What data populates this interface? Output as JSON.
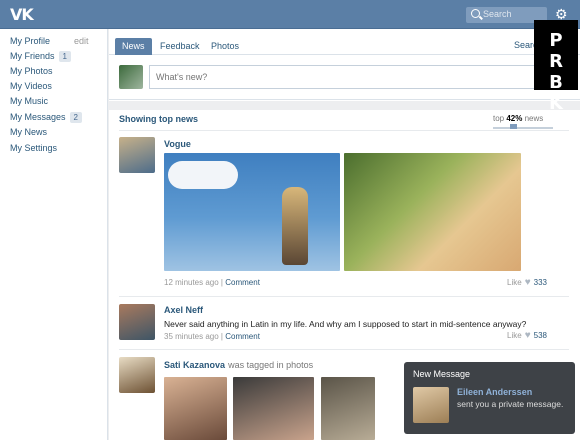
{
  "header": {
    "logo": "VK",
    "search_placeholder": "Search"
  },
  "sidebar": {
    "edit_label": "edit",
    "items": [
      {
        "label": "My Profile"
      },
      {
        "label": "My Friends",
        "badge": "1"
      },
      {
        "label": "My Photos"
      },
      {
        "label": "My Videos"
      },
      {
        "label": "My Music"
      },
      {
        "label": "My Messages",
        "badge": "2"
      },
      {
        "label": "My News"
      },
      {
        "label": "My Settings"
      }
    ]
  },
  "tabs": [
    {
      "label": "News",
      "active": true
    },
    {
      "label": "Feedback"
    },
    {
      "label": "Photos"
    }
  ],
  "tabs_search_label": "Searc",
  "composer": {
    "placeholder": "What's new?"
  },
  "feed": {
    "header": "Showing top news",
    "top_prefix": "top",
    "top_percent": "42%",
    "top_suffix": "news",
    "top_fraction": 0.42
  },
  "posts": [
    {
      "author": "Vogue",
      "time": "12 minutes ago",
      "comment": "Comment",
      "like": "Like",
      "likes": "333"
    },
    {
      "author": "Axel Neff",
      "text": "Never said anything in Latin in my life. And why am I supposed to start in mid-sentence anyway?",
      "time": "35 minutes ago",
      "comment": "Comment",
      "like": "Like",
      "likes": "538"
    },
    {
      "author": "Sati Kazanova",
      "tag_text": "was tagged in photos"
    }
  ],
  "brand": {
    "line1": "P",
    "line2": "R",
    "line3": "B",
    "line4": "K"
  },
  "toast": {
    "title": "New Message",
    "sender": "Eileen Anderssen",
    "message": "sent you a private message."
  }
}
